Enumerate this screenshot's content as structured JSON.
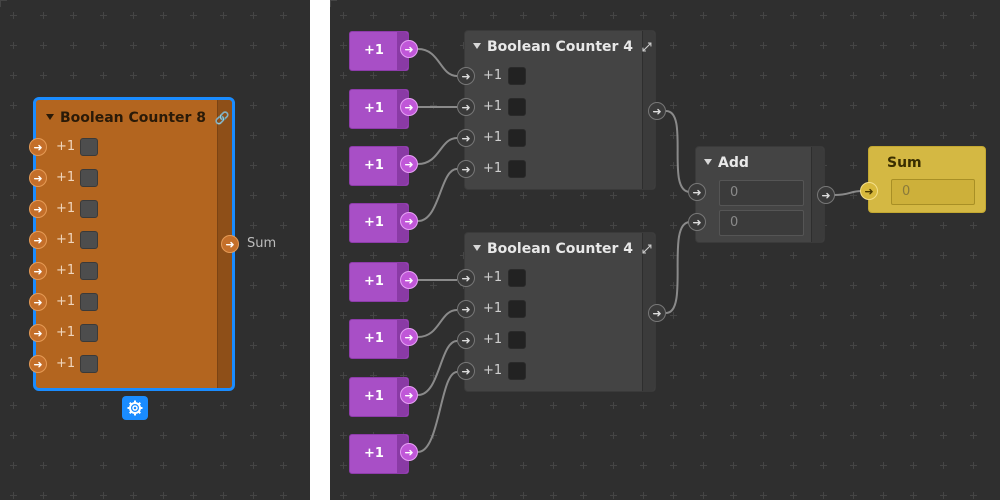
{
  "left_panel": {
    "node": {
      "title": "Boolean Counter 8",
      "link_icon": "link-icon",
      "inputs": [
        {
          "label": "+1"
        },
        {
          "label": "+1"
        },
        {
          "label": "+1"
        },
        {
          "label": "+1"
        },
        {
          "label": "+1"
        },
        {
          "label": "+1"
        },
        {
          "label": "+1"
        },
        {
          "label": "+1"
        }
      ],
      "output_label": "Sum",
      "settings_icon": "gear-icon"
    }
  },
  "right_panel": {
    "sources": [
      {
        "label": "+1"
      },
      {
        "label": "+1"
      },
      {
        "label": "+1"
      },
      {
        "label": "+1"
      },
      {
        "label": "+1"
      },
      {
        "label": "+1"
      },
      {
        "label": "+1"
      },
      {
        "label": "+1"
      }
    ],
    "counters": [
      {
        "title": "Boolean Counter 4",
        "icon": "expand-icon",
        "inputs": [
          {
            "label": "+1"
          },
          {
            "label": "+1"
          },
          {
            "label": "+1"
          },
          {
            "label": "+1"
          }
        ]
      },
      {
        "title": "Boolean Counter 4",
        "icon": "expand-icon",
        "inputs": [
          {
            "label": "+1"
          },
          {
            "label": "+1"
          },
          {
            "label": "+1"
          },
          {
            "label": "+1"
          }
        ]
      }
    ],
    "add_node": {
      "title": "Add",
      "fields": [
        "0",
        "0"
      ]
    },
    "sum_node": {
      "title": "Sum",
      "value": "0"
    }
  },
  "colors": {
    "canvas": "#2f2f2f",
    "selection": "#1a8cff",
    "orange_node": "#b3651f",
    "purple_node": "#a84fc6",
    "gold_node": "#d4b843"
  }
}
